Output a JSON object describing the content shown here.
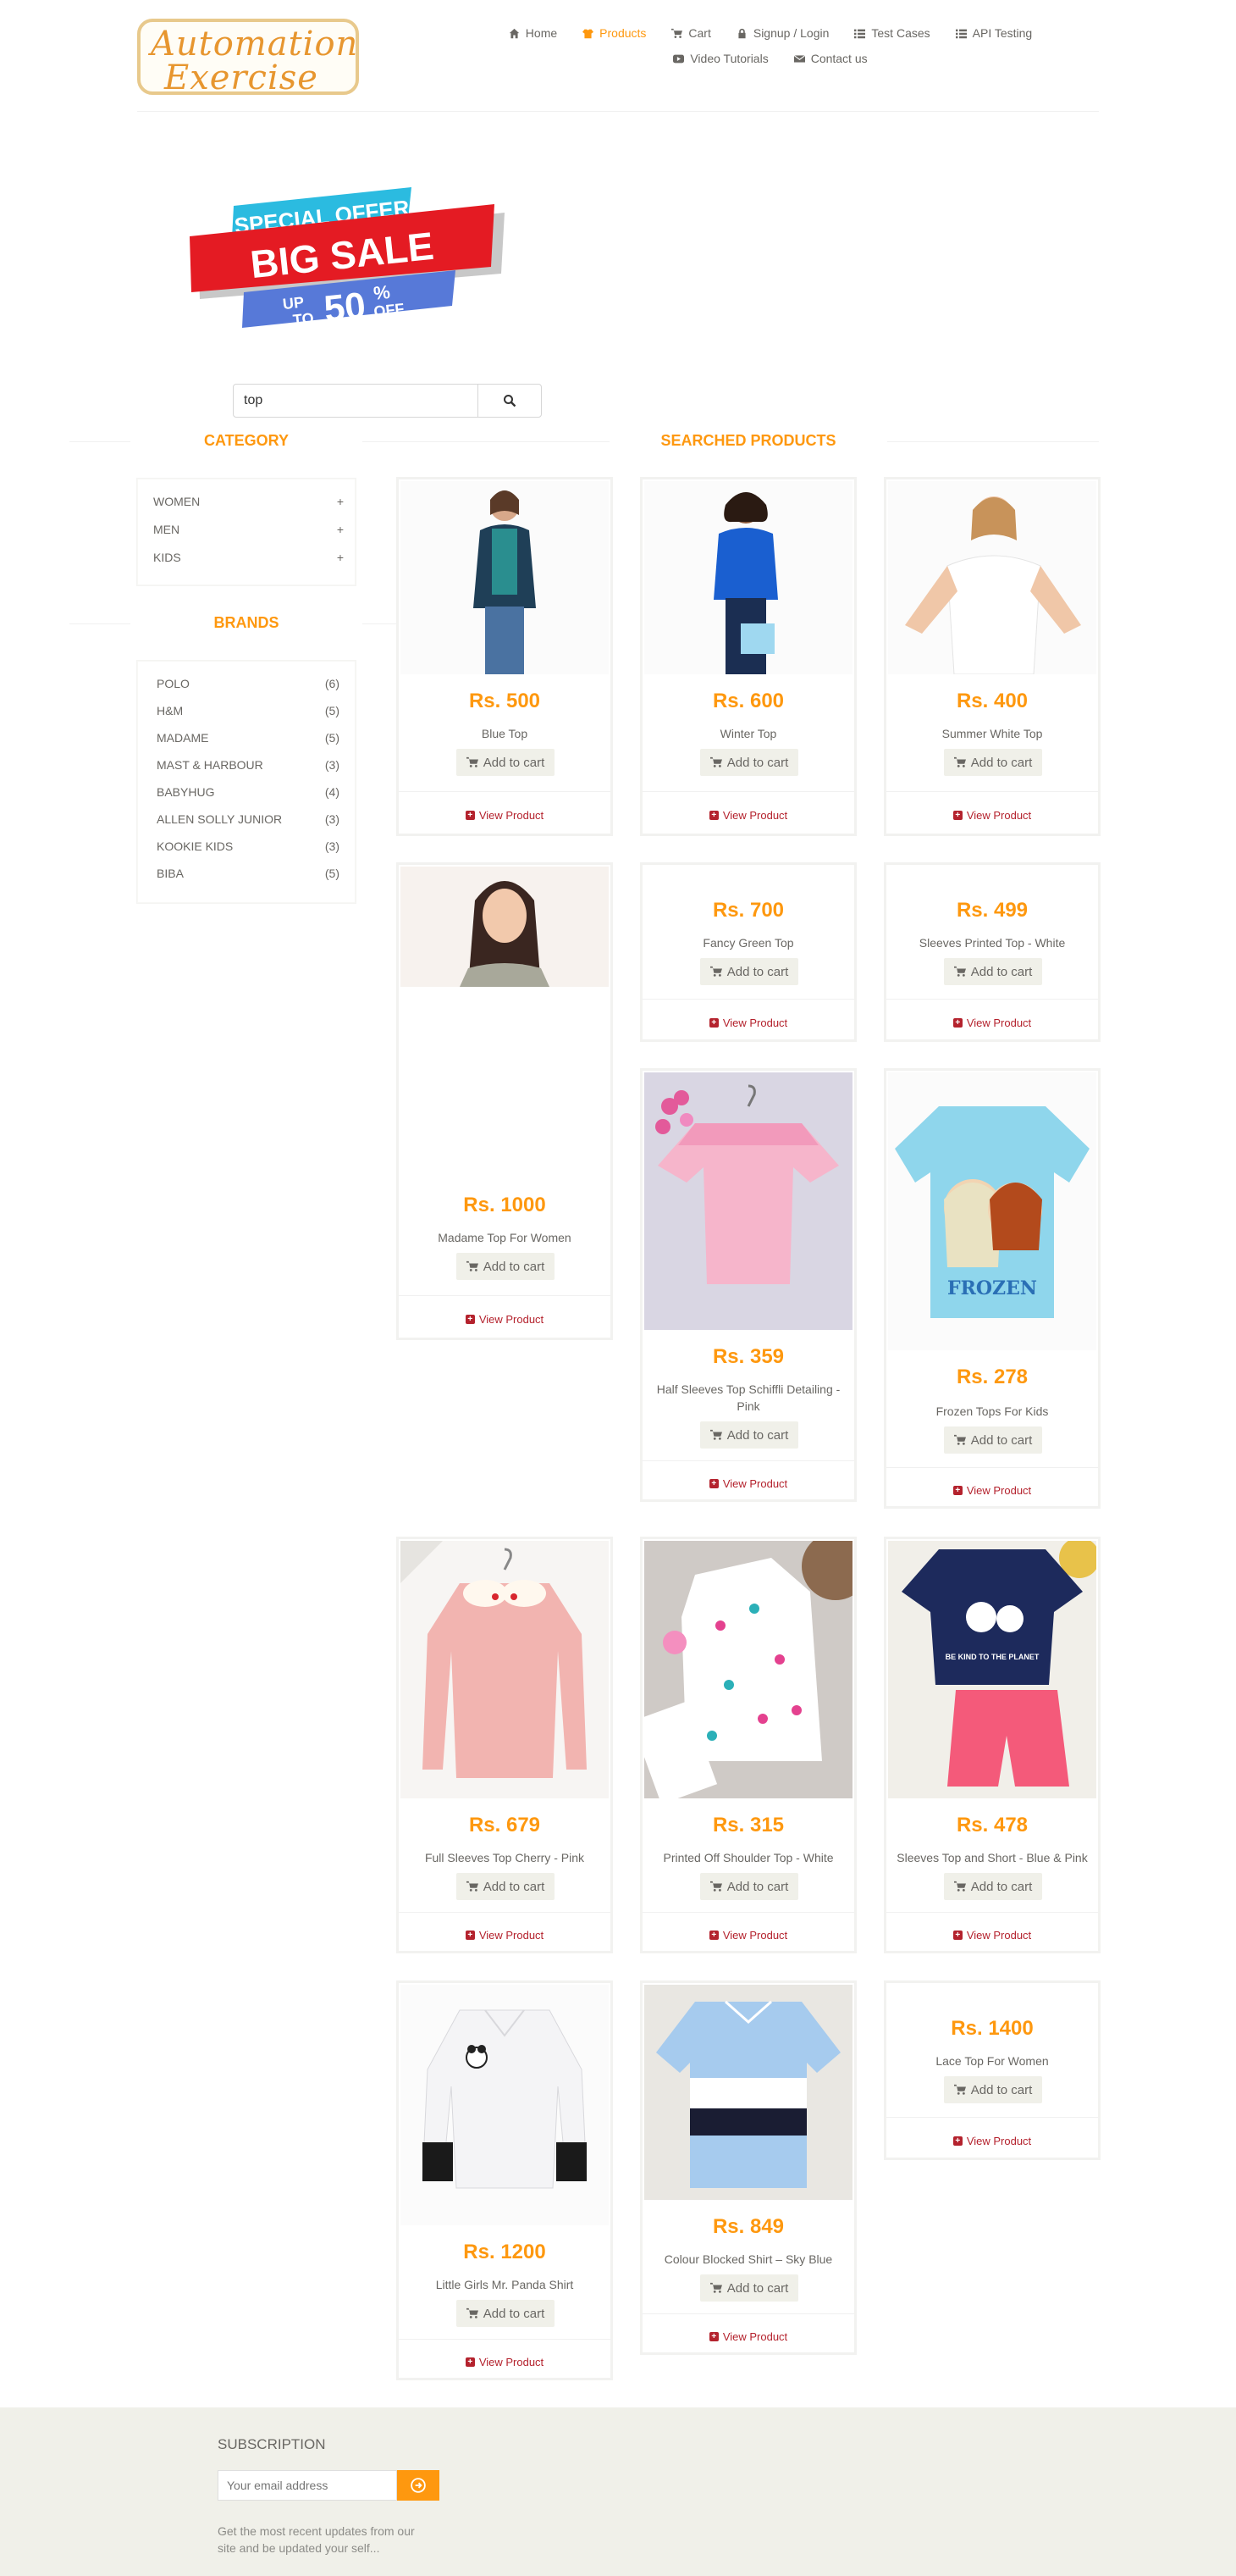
{
  "header": {
    "logo_text": "Automation Exercise",
    "logo_line1": "Automation",
    "logo_line2": "Exercise",
    "nav": [
      {
        "label": "Home",
        "icon": "home-icon",
        "active": false
      },
      {
        "label": "Products",
        "icon": "shirt-icon",
        "active": true
      },
      {
        "label": "Cart",
        "icon": "cart-icon",
        "active": false
      },
      {
        "label": "Signup / Login",
        "icon": "lock-icon",
        "active": false
      },
      {
        "label": "Test Cases",
        "icon": "list-icon",
        "active": false
      },
      {
        "label": "API Testing",
        "icon": "list-icon",
        "active": false
      },
      {
        "label": "Video Tutorials",
        "icon": "youtube-icon",
        "active": false
      },
      {
        "label": "Contact us",
        "icon": "envelope-icon",
        "active": false
      }
    ]
  },
  "banner": {
    "line1": "SPECIAL OFFER",
    "line2": "BIG SALE",
    "line3_a": "UP",
    "line3_b": "TO",
    "line3_c": "50",
    "line3_d": "%",
    "line3_e": "OFF"
  },
  "search": {
    "value": "top"
  },
  "sidebar": {
    "category_title": "CATEGORY",
    "categories": [
      "WOMEN",
      "MEN",
      "KIDS"
    ],
    "brands_title": "BRANDS",
    "brands": [
      {
        "name": "POLO",
        "count": "(6)"
      },
      {
        "name": "H&M",
        "count": "(5)"
      },
      {
        "name": "MADAME",
        "count": "(5)"
      },
      {
        "name": "MAST & HARBOUR",
        "count": "(3)"
      },
      {
        "name": "BABYHUG",
        "count": "(4)"
      },
      {
        "name": "ALLEN SOLLY JUNIOR",
        "count": "(3)"
      },
      {
        "name": "KOOKIE KIDS",
        "count": "(3)"
      },
      {
        "name": "BIBA",
        "count": "(5)"
      }
    ]
  },
  "products": {
    "title": "SEARCHED PRODUCTS",
    "add_label": "Add to cart",
    "view_label": "View Product",
    "items": [
      {
        "price": "Rs. 500",
        "name": "Blue Top"
      },
      {
        "price": "Rs. 600",
        "name": "Winter Top"
      },
      {
        "price": "Rs. 400",
        "name": "Summer White Top"
      },
      {
        "price": "Rs. 1000",
        "name": "Madame Top For Women"
      },
      {
        "price": "Rs. 700",
        "name": "Fancy Green Top"
      },
      {
        "price": "Rs. 499",
        "name": "Sleeves Printed Top - White"
      },
      {
        "price": "Rs. 359",
        "name": "Half Sleeves Top Schiffli Detailing - Pink"
      },
      {
        "price": "Rs. 278",
        "name": "Frozen Tops For Kids"
      },
      {
        "price": "Rs. 679",
        "name": "Full Sleeves Top Cherry - Pink"
      },
      {
        "price": "Rs. 315",
        "name": "Printed Off Shoulder Top - White"
      },
      {
        "price": "Rs. 478",
        "name": "Sleeves Top and Short - Blue & Pink"
      },
      {
        "price": "Rs. 1200",
        "name": "Little Girls Mr. Panda Shirt"
      },
      {
        "price": "Rs. 849",
        "name": "Colour Blocked Shirt – Sky Blue"
      },
      {
        "price": "Rs. 1400",
        "name": "Lace Top For Women"
      }
    ]
  },
  "footer": {
    "subscription_title": "SUBSCRIPTION",
    "email_placeholder": "Your email address",
    "subscription_text": "Get the most recent updates from our site and be updated your self..."
  },
  "colors": {
    "accent": "#fe980f",
    "view_link": "#b4222d",
    "footer_bg": "#f0f0e9"
  }
}
